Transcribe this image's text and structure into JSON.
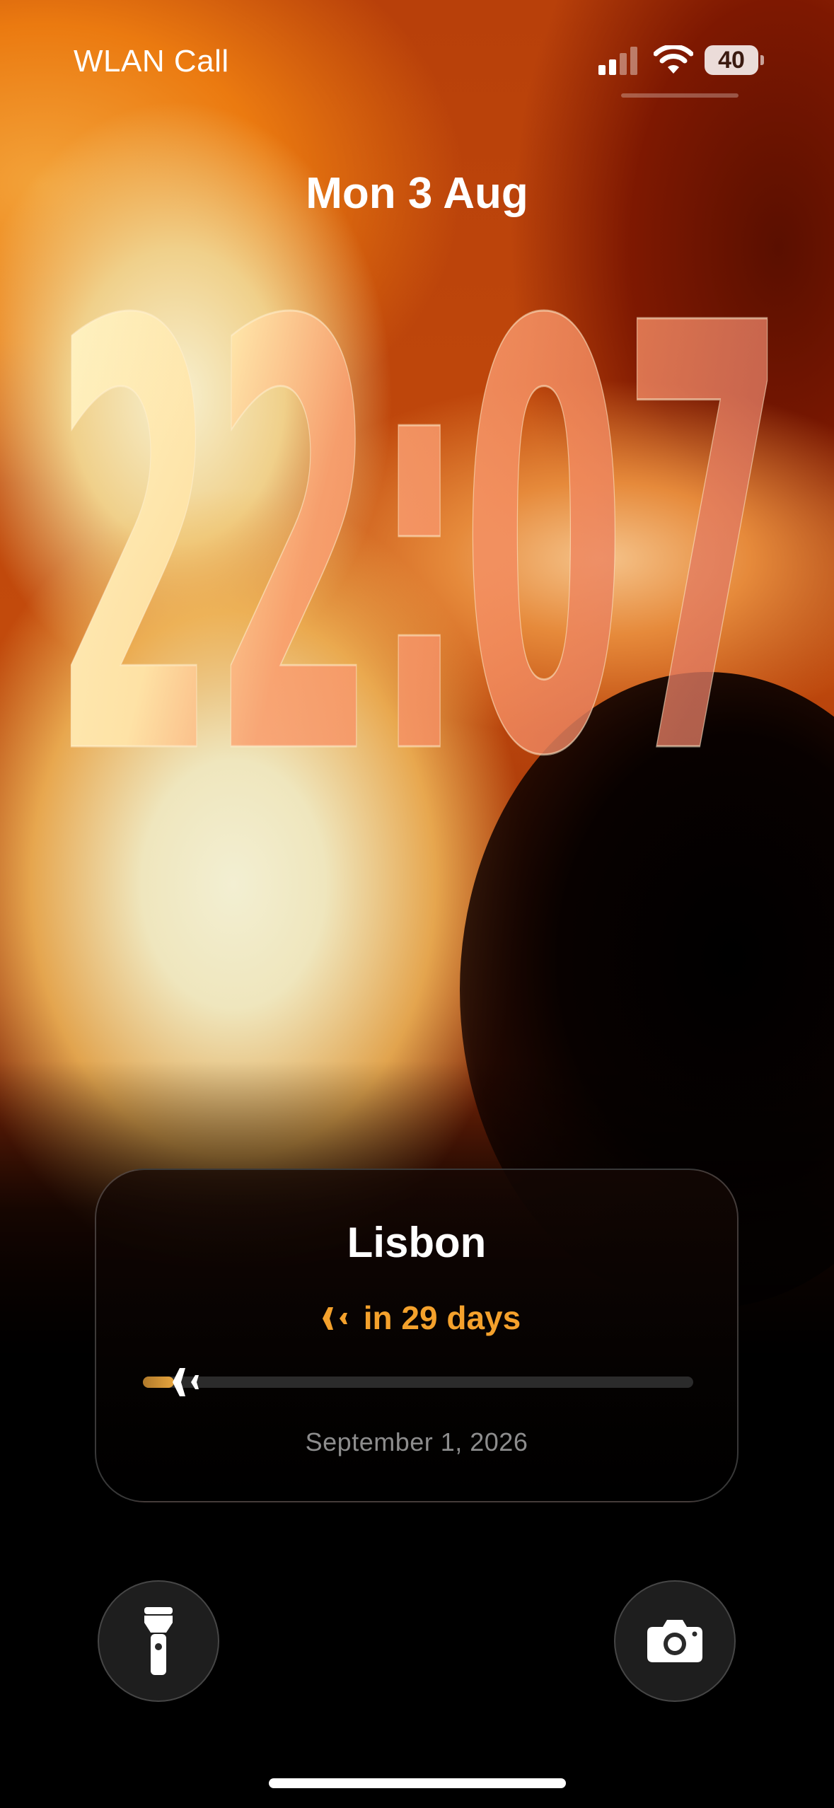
{
  "status_bar": {
    "carrier": "WLAN Call",
    "signal_icon": "cellular-signal-icon",
    "wifi_icon": "wifi-icon",
    "battery_level": "40"
  },
  "lock_screen": {
    "date": "Mon 3 Aug",
    "time": "22:07"
  },
  "widget": {
    "title": "Lisbon",
    "plane_icon": "airplane-icon",
    "countdown": "in 29 days",
    "progress": 0.05,
    "date": "September 1, 2026",
    "accent_color": "#f4a12c"
  },
  "quick_actions": {
    "left": "flashlight-icon",
    "right": "camera-icon"
  }
}
